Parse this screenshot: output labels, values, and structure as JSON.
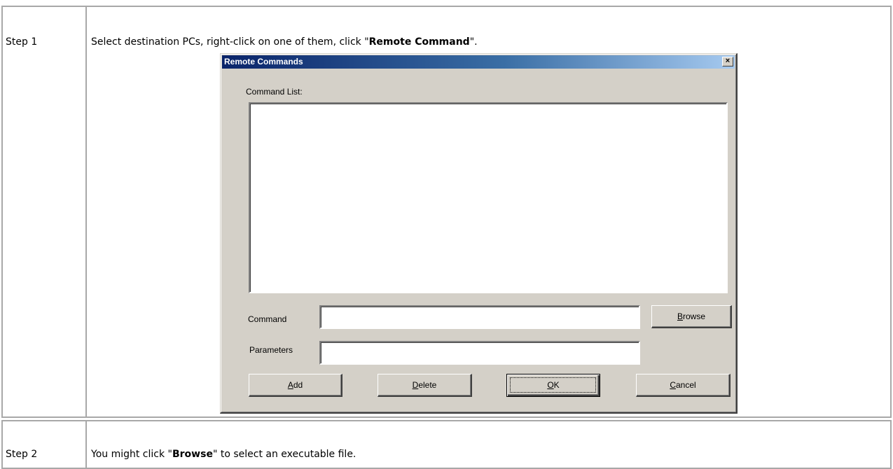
{
  "rows": [
    {
      "step_label": "Step 1",
      "instruction_prefix": "Select destination PCs, right-click on one of them, click \"",
      "instruction_bold": "Remote Command",
      "instruction_suffix": "\"."
    },
    {
      "step_label": "Step 2",
      "instruction_prefix": "You might click \"",
      "instruction_bold": "Browse",
      "instruction_suffix": "\" to select an executable file."
    }
  ],
  "dialog": {
    "title": "Remote Commands",
    "close_glyph": "×",
    "command_list_label": "Command List:",
    "command_label": "Command",
    "command_value": "",
    "parameters_label": "Parameters",
    "parameters_value": "",
    "browse_button": {
      "mnemonic": "B",
      "rest": "rowse"
    },
    "add_button": {
      "mnemonic": "A",
      "rest": "dd"
    },
    "delete_button": {
      "mnemonic": "D",
      "rest": "elete"
    },
    "ok_button": {
      "mnemonic": "O",
      "rest": "K"
    },
    "cancel_button": {
      "mnemonic": "C",
      "rest": "ancel"
    }
  },
  "colors": {
    "titlebar_start": "#0a246a",
    "titlebar_end": "#a6caf0",
    "dialog_face": "#d4d0c8",
    "table_border": "#a8a8a8"
  }
}
